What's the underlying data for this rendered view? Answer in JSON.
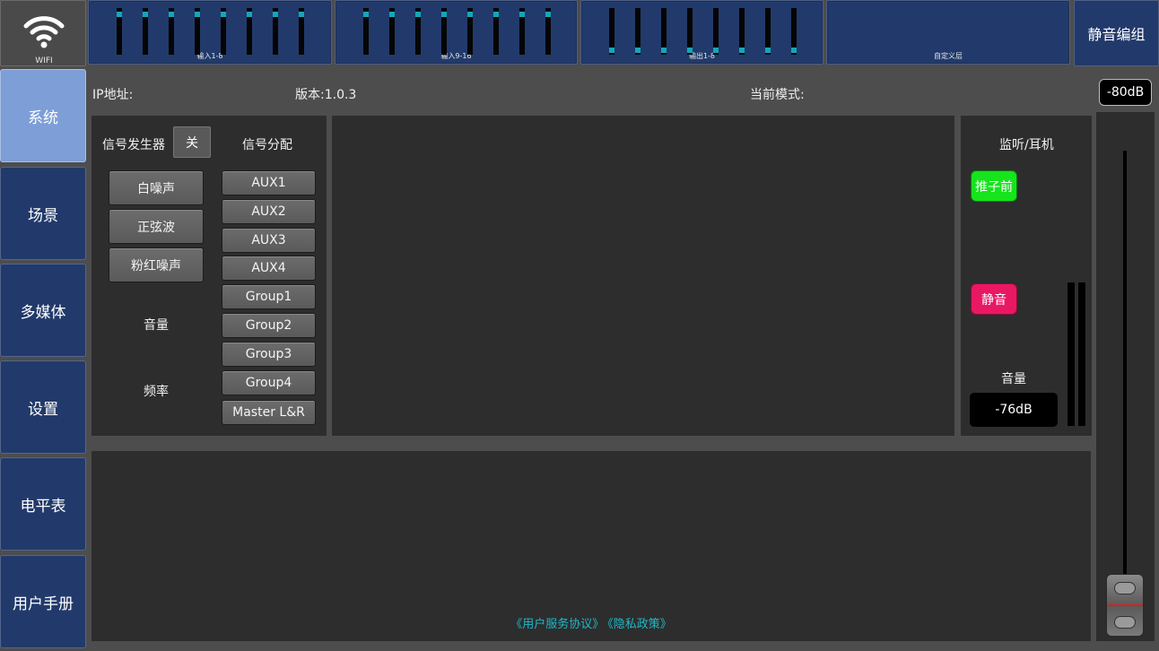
{
  "top": {
    "wifi_label": "WIFI",
    "panels": [
      {
        "caption": "输入1-8"
      },
      {
        "caption": "输入9-16"
      },
      {
        "caption": "输出1-8"
      },
      {
        "caption": "自定义层"
      }
    ],
    "mute_group_label": "静音编组"
  },
  "nav": {
    "items": [
      {
        "label": "系统",
        "active": true
      },
      {
        "label": "场景"
      },
      {
        "label": "多媒体"
      },
      {
        "label": "设置"
      },
      {
        "label": "电平表"
      },
      {
        "label": "用户手册"
      }
    ]
  },
  "info": {
    "ip_label": "IP地址:",
    "version_label": "版本:1.0.3",
    "mode_label": "当前模式:",
    "master_db": "-80dB"
  },
  "signal": {
    "generator_label": "信号发生器",
    "generator_toggle": "关",
    "types": [
      "白噪声",
      "正弦波",
      "粉红噪声"
    ],
    "volume_label": "音量",
    "frequency_label": "频率",
    "routing_label": "信号分配",
    "routes": [
      "AUX1",
      "AUX2",
      "AUX3",
      "AUX4",
      "Group1",
      "Group2",
      "Group3",
      "Group4",
      "Master L&R"
    ]
  },
  "monitor": {
    "title": "监听/耳机",
    "prefader_label": "推子前",
    "mute_label": "静音",
    "volume_label": "音量",
    "volume_value": "-76dB"
  },
  "footer": {
    "user_agreement": "《用户服务协议》",
    "privacy_policy": "《隐私政策》"
  },
  "colors": {
    "accent_teal": "#15a6b8",
    "nav_active": "#7d9ed7",
    "prefader_green": "#16e41c",
    "mute_pink": "#ea1763"
  }
}
